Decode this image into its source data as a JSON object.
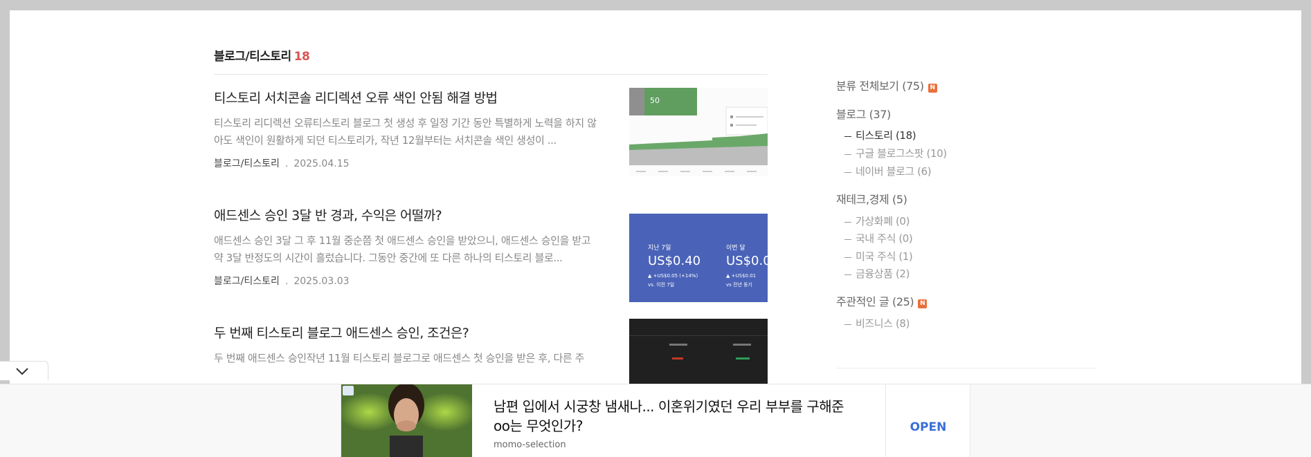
{
  "category": {
    "name": "블로그/티스토리",
    "count": "18"
  },
  "posts": [
    {
      "title": "티스토리 서치콘솔 리디렉션 오류 색인 안됨 해결 방법",
      "excerpt": "티스토리 리디렉션 오류티스토리 블로그 첫 생성 후 일정 기간 동안 특별하게 노력을 하지 않아도 색인이 원활하게 되던 티스토리가, 작년 12월부터는 서치콘솔 색인 생성이 ...",
      "category": "블로그/티스토리",
      "date": "2025.04.15",
      "thumb": {
        "badge_value": "50"
      }
    },
    {
      "title": "애드센스 승인 3달 반 경과, 수익은 어떨까?",
      "excerpt": "애드센스 승인 3달 그 후 11월 중순쯤 첫 애드센스 승인을 받았으니, 애드센스 승인을 받고 약 3달 반정도의 시간이 흘렀습니다. 그동안 중간에 또 다른 하나의 티스토리 블로...",
      "category": "블로그/티스토리",
      "date": "2025.03.03",
      "thumb": {
        "col1_label": "지난 7일",
        "col1_value": "US$0.40",
        "col1_delta": "▲ +US$0.05 (+14%)",
        "col1_vs": "vs. 이전 7일",
        "col2_label": "이번 달",
        "col2_value": "US$0.0",
        "col2_delta": "▲ +US$0.01",
        "col2_vs": "vs 전년 동기"
      }
    },
    {
      "title": "두 번째 티스토리 블로그 애드센스 승인, 조건은?",
      "excerpt": "두 번째 애드센스 승인작년 11월 티스토리 블로그로 애드센스 첫 승인을 받은 후, 다른 주",
      "category": "",
      "date": "",
      "thumb": {}
    }
  ],
  "sidebar": {
    "all": {
      "label": "분류 전체보기 (75)",
      "badge": "N"
    },
    "groups": [
      {
        "label": "블로그 (37)",
        "badge": "",
        "children": [
          {
            "label": "티스토리 (18)",
            "active": true
          },
          {
            "label": "구글 블로그스팟 (10)",
            "active": false
          },
          {
            "label": "네이버 블로그 (6)",
            "active": false
          }
        ]
      },
      {
        "label": "재테크,경제 (5)",
        "badge": "",
        "children": [
          {
            "label": "가상화폐 (0)",
            "active": false
          },
          {
            "label": "국내 주식 (0)",
            "active": false
          },
          {
            "label": "미국 주식 (1)",
            "active": false
          },
          {
            "label": "금융상품 (2)",
            "active": false
          }
        ]
      },
      {
        "label": "주관적인 글 (25)",
        "badge": "N",
        "children": [
          {
            "label": "비즈니스 (8)",
            "active": false
          }
        ]
      }
    ]
  },
  "ad": {
    "headline": "남편 입에서 시궁창 냄새나... 이혼위기였던 우리 부부를 구해준 oo는 무엇인가?",
    "source": "momo-selection",
    "cta": "OPEN"
  },
  "colors": {
    "accent_count": "#d9534f",
    "badge": "#e8703a",
    "ad_cta": "#3a6fd8",
    "thumb2_bg": "#4a63b8"
  }
}
